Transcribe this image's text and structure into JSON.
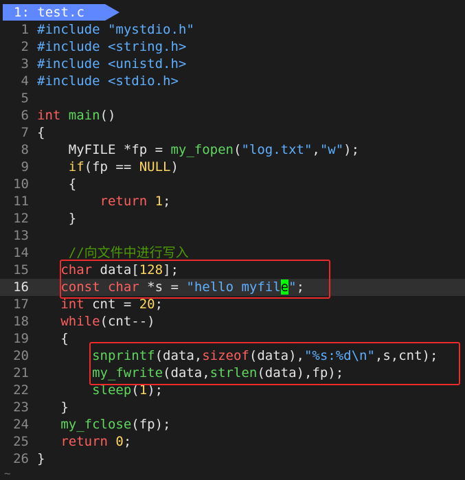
{
  "tab": {
    "label": "1: test.c"
  },
  "lines": [
    {
      "n": "1",
      "parts": [
        {
          "c": "pp",
          "t": "#include "
        },
        {
          "c": "str",
          "t": "\"mystdio.h\""
        }
      ]
    },
    {
      "n": "2",
      "parts": [
        {
          "c": "pp",
          "t": "#include <string.h>"
        }
      ]
    },
    {
      "n": "3",
      "parts": [
        {
          "c": "pp",
          "t": "#include <unistd.h>"
        }
      ]
    },
    {
      "n": "4",
      "parts": [
        {
          "c": "pp",
          "t": "#include <stdio.h>"
        }
      ]
    },
    {
      "n": "5",
      "parts": []
    },
    {
      "n": "6",
      "parts": [
        {
          "c": "kw",
          "t": "int "
        },
        {
          "c": "fn",
          "t": "main"
        },
        {
          "c": "",
          "t": "()"
        }
      ]
    },
    {
      "n": "7",
      "parts": [
        {
          "c": "",
          "t": "{"
        }
      ]
    },
    {
      "n": "8",
      "parts": [
        {
          "c": "",
          "t": "    MyFILE *fp = "
        },
        {
          "c": "fn",
          "t": "my_fopen"
        },
        {
          "c": "",
          "t": "("
        },
        {
          "c": "str",
          "t": "\"log.txt\""
        },
        {
          "c": "",
          "t": ","
        },
        {
          "c": "str",
          "t": "\"w\""
        },
        {
          "c": "",
          "t": ");"
        }
      ]
    },
    {
      "n": "9",
      "parts": [
        {
          "c": "",
          "t": "    "
        },
        {
          "c": "num",
          "t": "if"
        },
        {
          "c": "",
          "t": "(fp == "
        },
        {
          "c": "num",
          "t": "NULL"
        },
        {
          "c": "",
          "t": ")"
        }
      ]
    },
    {
      "n": "10",
      "parts": [
        {
          "c": "",
          "t": "    {"
        }
      ]
    },
    {
      "n": "11",
      "parts": [
        {
          "c": "",
          "t": "        "
        },
        {
          "c": "kw",
          "t": "return "
        },
        {
          "c": "num",
          "t": "1"
        },
        {
          "c": "",
          "t": ";"
        }
      ]
    },
    {
      "n": "12",
      "parts": [
        {
          "c": "",
          "t": "    }"
        }
      ]
    },
    {
      "n": "13",
      "parts": []
    },
    {
      "n": "14",
      "parts": [
        {
          "c": "",
          "t": "    "
        },
        {
          "c": "cmt",
          "t": "//向文件中进行写入"
        }
      ]
    },
    {
      "n": "15",
      "parts": [
        {
          "c": "",
          "t": "   "
        },
        {
          "c": "kw",
          "t": "char "
        },
        {
          "c": "",
          "t": "data["
        },
        {
          "c": "num",
          "t": "128"
        },
        {
          "c": "",
          "t": "];"
        }
      ]
    },
    {
      "n": "16",
      "cursor": true,
      "parts": [
        {
          "c": "",
          "t": "   "
        },
        {
          "c": "kw",
          "t": "const char "
        },
        {
          "c": "",
          "t": "*s = "
        },
        {
          "c": "str",
          "t": "\"hello myfil"
        },
        {
          "c": "cur",
          "t": "e"
        },
        {
          "c": "str",
          "t": "\""
        },
        {
          "c": "",
          "t": ";"
        }
      ]
    },
    {
      "n": "17",
      "parts": [
        {
          "c": "",
          "t": "   "
        },
        {
          "c": "kw",
          "t": "int "
        },
        {
          "c": "",
          "t": "cnt = "
        },
        {
          "c": "num",
          "t": "20"
        },
        {
          "c": "",
          "t": ";"
        }
      ]
    },
    {
      "n": "18",
      "parts": [
        {
          "c": "",
          "t": "   "
        },
        {
          "c": "kw",
          "t": "while"
        },
        {
          "c": "",
          "t": "(cnt--)"
        }
      ]
    },
    {
      "n": "19",
      "parts": [
        {
          "c": "",
          "t": "   {"
        }
      ]
    },
    {
      "n": "20",
      "parts": [
        {
          "c": "",
          "t": "       "
        },
        {
          "c": "fn",
          "t": "snprintf"
        },
        {
          "c": "",
          "t": "(data,"
        },
        {
          "c": "kw",
          "t": "sizeof"
        },
        {
          "c": "",
          "t": "(data),"
        },
        {
          "c": "str",
          "t": "\"%s:%d\\n\""
        },
        {
          "c": "",
          "t": ",s,cnt);"
        }
      ]
    },
    {
      "n": "21",
      "parts": [
        {
          "c": "",
          "t": "       "
        },
        {
          "c": "fn",
          "t": "my_fwrite"
        },
        {
          "c": "",
          "t": "(data,"
        },
        {
          "c": "fn",
          "t": "strlen"
        },
        {
          "c": "",
          "t": "(data),fp);"
        }
      ]
    },
    {
      "n": "22",
      "parts": [
        {
          "c": "",
          "t": "       "
        },
        {
          "c": "fn",
          "t": "sleep"
        },
        {
          "c": "",
          "t": "("
        },
        {
          "c": "num",
          "t": "1"
        },
        {
          "c": "",
          "t": ");"
        }
      ]
    },
    {
      "n": "23",
      "parts": [
        {
          "c": "",
          "t": "   }"
        }
      ]
    },
    {
      "n": "24",
      "parts": [
        {
          "c": "",
          "t": "   "
        },
        {
          "c": "fn",
          "t": "my_fclose"
        },
        {
          "c": "",
          "t": "(fp);"
        }
      ]
    },
    {
      "n": "25",
      "parts": [
        {
          "c": "",
          "t": "   "
        },
        {
          "c": "kw",
          "t": "return "
        },
        {
          "c": "num",
          "t": "0"
        },
        {
          "c": "",
          "t": ";"
        }
      ]
    },
    {
      "n": "26",
      "parts": [
        {
          "c": "",
          "t": "}"
        }
      ]
    }
  ],
  "end_marker": "~",
  "colors": {
    "tab_bg": "#5f87ff",
    "keyword": "#ff5f5f",
    "function": "#5fd75f",
    "string": "#5fafff",
    "number": "#ffd75f",
    "comment": "#4e9a06",
    "cursor": "#00ff00",
    "highlight_box": "#ee2b2b"
  }
}
